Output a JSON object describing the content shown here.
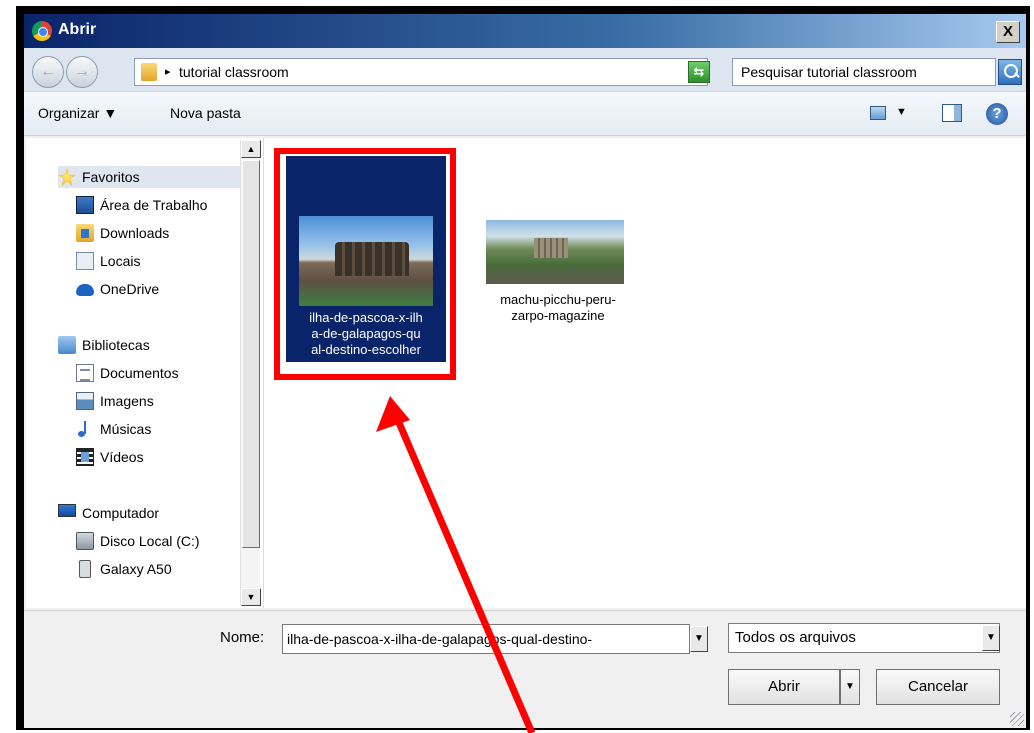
{
  "window": {
    "title": "Abrir",
    "close_label": "X"
  },
  "address_bar": {
    "back_label": "←",
    "forward_label": "→",
    "breadcrumb_arrow": "▸",
    "path": "tutorial classroom",
    "dropdown_label": "▼",
    "search_placeholder": "Pesquisar tutorial classroom"
  },
  "toolbar": {
    "organize_label": "Organizar ▼",
    "new_folder_label": "Nova pasta",
    "view_arrow": "▼",
    "help_label": "?"
  },
  "navigation": {
    "favorites": {
      "label": "Favoritos",
      "items": [
        "Área de Trabalho",
        "Downloads",
        "Locais",
        "OneDrive"
      ]
    },
    "libraries": {
      "label": "Bibliotecas",
      "items": [
        "Documentos",
        "Imagens",
        "Músicas",
        "Vídeos"
      ]
    },
    "computer": {
      "label": "Computador",
      "items": [
        "Disco Local (C:)",
        "Galaxy A50"
      ]
    },
    "scroll_up": "▲",
    "scroll_down": "▼"
  },
  "files": [
    {
      "name": "ilha-de-pascoa-x-ilha-de-galapagos-qual-destino-escolher",
      "lines": [
        "ilha-de-pascoa-x-ilh",
        "a-de-galapagos-qu",
        "al-destino-escolher"
      ],
      "selected": true,
      "thumbnail_icon": "easter-island-photo-icon"
    },
    {
      "name": "machu-picchu-peru-zarpo-magazine",
      "lines": [
        "machu-picchu-peru-",
        "zarpo-magazine"
      ],
      "selected": false,
      "thumbnail_icon": "machu-picchu-photo-icon"
    }
  ],
  "footer": {
    "name_label": "Nome:",
    "name_value": "ilha-de-pascoa-x-ilha-de-galapagos-qual-destino-",
    "combo_arrow": "▼",
    "filter_value": "Todos os arquivos",
    "open_label": "Abrir",
    "open_split_arrow": "▼",
    "cancel_label": "Cancelar"
  },
  "colors": {
    "selection": "#0a246a",
    "highlight_box": "#ff0000",
    "arrow": "#ff0000"
  }
}
